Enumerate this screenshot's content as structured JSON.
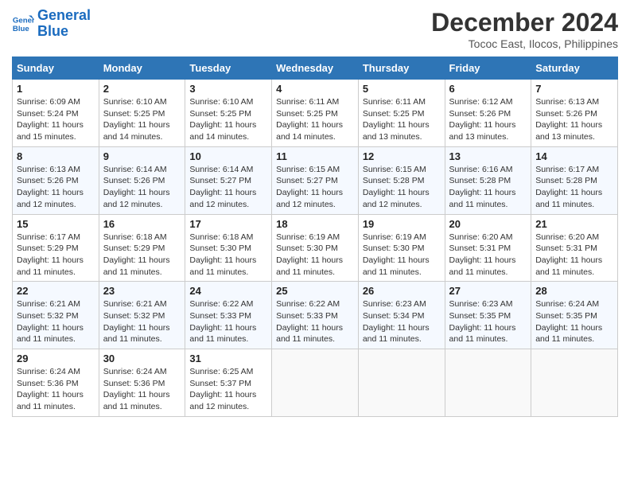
{
  "header": {
    "logo_line1": "General",
    "logo_line2": "Blue",
    "month": "December 2024",
    "location": "Tococ East, Ilocos, Philippines"
  },
  "weekdays": [
    "Sunday",
    "Monday",
    "Tuesday",
    "Wednesday",
    "Thursday",
    "Friday",
    "Saturday"
  ],
  "weeks": [
    [
      {
        "day": "1",
        "sunrise": "Sunrise: 6:09 AM",
        "sunset": "Sunset: 5:24 PM",
        "daylight": "Daylight: 11 hours and 15 minutes."
      },
      {
        "day": "2",
        "sunrise": "Sunrise: 6:10 AM",
        "sunset": "Sunset: 5:25 PM",
        "daylight": "Daylight: 11 hours and 14 minutes."
      },
      {
        "day": "3",
        "sunrise": "Sunrise: 6:10 AM",
        "sunset": "Sunset: 5:25 PM",
        "daylight": "Daylight: 11 hours and 14 minutes."
      },
      {
        "day": "4",
        "sunrise": "Sunrise: 6:11 AM",
        "sunset": "Sunset: 5:25 PM",
        "daylight": "Daylight: 11 hours and 14 minutes."
      },
      {
        "day": "5",
        "sunrise": "Sunrise: 6:11 AM",
        "sunset": "Sunset: 5:25 PM",
        "daylight": "Daylight: 11 hours and 13 minutes."
      },
      {
        "day": "6",
        "sunrise": "Sunrise: 6:12 AM",
        "sunset": "Sunset: 5:26 PM",
        "daylight": "Daylight: 11 hours and 13 minutes."
      },
      {
        "day": "7",
        "sunrise": "Sunrise: 6:13 AM",
        "sunset": "Sunset: 5:26 PM",
        "daylight": "Daylight: 11 hours and 13 minutes."
      }
    ],
    [
      {
        "day": "8",
        "sunrise": "Sunrise: 6:13 AM",
        "sunset": "Sunset: 5:26 PM",
        "daylight": "Daylight: 11 hours and 12 minutes."
      },
      {
        "day": "9",
        "sunrise": "Sunrise: 6:14 AM",
        "sunset": "Sunset: 5:26 PM",
        "daylight": "Daylight: 11 hours and 12 minutes."
      },
      {
        "day": "10",
        "sunrise": "Sunrise: 6:14 AM",
        "sunset": "Sunset: 5:27 PM",
        "daylight": "Daylight: 11 hours and 12 minutes."
      },
      {
        "day": "11",
        "sunrise": "Sunrise: 6:15 AM",
        "sunset": "Sunset: 5:27 PM",
        "daylight": "Daylight: 11 hours and 12 minutes."
      },
      {
        "day": "12",
        "sunrise": "Sunrise: 6:15 AM",
        "sunset": "Sunset: 5:28 PM",
        "daylight": "Daylight: 11 hours and 12 minutes."
      },
      {
        "day": "13",
        "sunrise": "Sunrise: 6:16 AM",
        "sunset": "Sunset: 5:28 PM",
        "daylight": "Daylight: 11 hours and 11 minutes."
      },
      {
        "day": "14",
        "sunrise": "Sunrise: 6:17 AM",
        "sunset": "Sunset: 5:28 PM",
        "daylight": "Daylight: 11 hours and 11 minutes."
      }
    ],
    [
      {
        "day": "15",
        "sunrise": "Sunrise: 6:17 AM",
        "sunset": "Sunset: 5:29 PM",
        "daylight": "Daylight: 11 hours and 11 minutes."
      },
      {
        "day": "16",
        "sunrise": "Sunrise: 6:18 AM",
        "sunset": "Sunset: 5:29 PM",
        "daylight": "Daylight: 11 hours and 11 minutes."
      },
      {
        "day": "17",
        "sunrise": "Sunrise: 6:18 AM",
        "sunset": "Sunset: 5:30 PM",
        "daylight": "Daylight: 11 hours and 11 minutes."
      },
      {
        "day": "18",
        "sunrise": "Sunrise: 6:19 AM",
        "sunset": "Sunset: 5:30 PM",
        "daylight": "Daylight: 11 hours and 11 minutes."
      },
      {
        "day": "19",
        "sunrise": "Sunrise: 6:19 AM",
        "sunset": "Sunset: 5:30 PM",
        "daylight": "Daylight: 11 hours and 11 minutes."
      },
      {
        "day": "20",
        "sunrise": "Sunrise: 6:20 AM",
        "sunset": "Sunset: 5:31 PM",
        "daylight": "Daylight: 11 hours and 11 minutes."
      },
      {
        "day": "21",
        "sunrise": "Sunrise: 6:20 AM",
        "sunset": "Sunset: 5:31 PM",
        "daylight": "Daylight: 11 hours and 11 minutes."
      }
    ],
    [
      {
        "day": "22",
        "sunrise": "Sunrise: 6:21 AM",
        "sunset": "Sunset: 5:32 PM",
        "daylight": "Daylight: 11 hours and 11 minutes."
      },
      {
        "day": "23",
        "sunrise": "Sunrise: 6:21 AM",
        "sunset": "Sunset: 5:32 PM",
        "daylight": "Daylight: 11 hours and 11 minutes."
      },
      {
        "day": "24",
        "sunrise": "Sunrise: 6:22 AM",
        "sunset": "Sunset: 5:33 PM",
        "daylight": "Daylight: 11 hours and 11 minutes."
      },
      {
        "day": "25",
        "sunrise": "Sunrise: 6:22 AM",
        "sunset": "Sunset: 5:33 PM",
        "daylight": "Daylight: 11 hours and 11 minutes."
      },
      {
        "day": "26",
        "sunrise": "Sunrise: 6:23 AM",
        "sunset": "Sunset: 5:34 PM",
        "daylight": "Daylight: 11 hours and 11 minutes."
      },
      {
        "day": "27",
        "sunrise": "Sunrise: 6:23 AM",
        "sunset": "Sunset: 5:35 PM",
        "daylight": "Daylight: 11 hours and 11 minutes."
      },
      {
        "day": "28",
        "sunrise": "Sunrise: 6:24 AM",
        "sunset": "Sunset: 5:35 PM",
        "daylight": "Daylight: 11 hours and 11 minutes."
      }
    ],
    [
      {
        "day": "29",
        "sunrise": "Sunrise: 6:24 AM",
        "sunset": "Sunset: 5:36 PM",
        "daylight": "Daylight: 11 hours and 11 minutes."
      },
      {
        "day": "30",
        "sunrise": "Sunrise: 6:24 AM",
        "sunset": "Sunset: 5:36 PM",
        "daylight": "Daylight: 11 hours and 11 minutes."
      },
      {
        "day": "31",
        "sunrise": "Sunrise: 6:25 AM",
        "sunset": "Sunset: 5:37 PM",
        "daylight": "Daylight: 11 hours and 12 minutes."
      },
      null,
      null,
      null,
      null
    ]
  ]
}
